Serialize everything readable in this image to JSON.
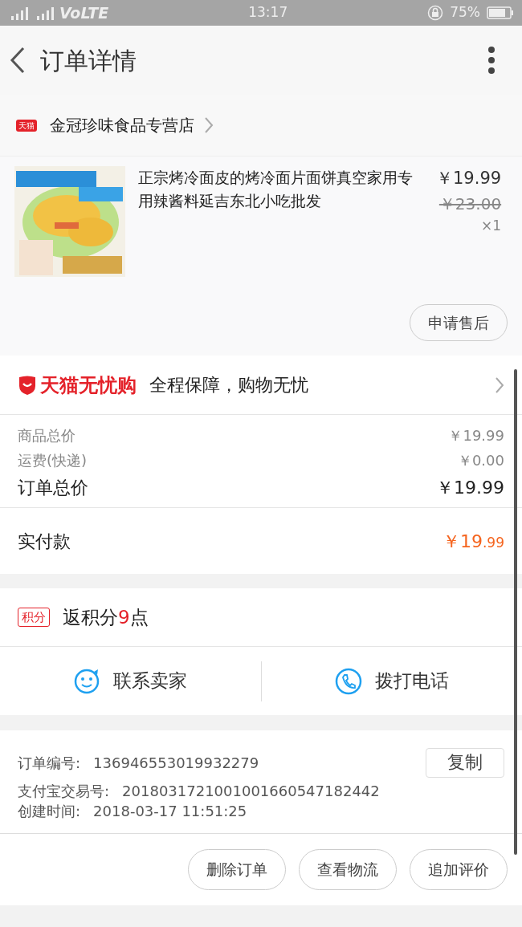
{
  "status_bar": {
    "network": "VoLTE",
    "time": "13:17",
    "battery": "75%"
  },
  "header": {
    "title": "订单详情"
  },
  "shop": {
    "badge": "天猫",
    "name": "金冠珍味食品专营店"
  },
  "product": {
    "kind": "picture",
    "title": "正宗烤冷面皮的烤冷面片面饼真空家用专用辣酱料延吉东北小吃批发",
    "price": "￥19.99",
    "original_price": "￥23.00",
    "quantity": "×1",
    "after_sale_button": "申请售后"
  },
  "guarantee": {
    "brand": "天猫无忧购",
    "text": "全程保障，购物无忧"
  },
  "summary": [
    {
      "kind": "minor",
      "label": "商品总价",
      "value": "￥19.99"
    },
    {
      "kind": "minor",
      "label": "运费(快递)",
      "value": "￥0.00"
    },
    {
      "kind": "major",
      "label": "订单总价",
      "value": "￥19.99"
    }
  ],
  "paid": {
    "label": "实付款",
    "value_main": "￥19",
    "value_cents": ".99"
  },
  "points": {
    "badge": "积分",
    "text_before": "返积分",
    "points": "9",
    "text_after": "点"
  },
  "contact": [
    {
      "kind": "chat",
      "label": "联系卖家"
    },
    {
      "kind": "phone",
      "label": "拨打电话"
    }
  ],
  "order_info": [
    {
      "label": "订单编号:",
      "value": "136946553019932279",
      "copy_button": "复制"
    },
    {
      "label": "支付宝交易号:",
      "value": "2018031721001001660547182442"
    },
    {
      "label": "创建时间:",
      "value": "2018-03-17 11:51:25"
    }
  ],
  "actions": [
    "删除订单",
    "查看物流",
    "追加评价"
  ]
}
